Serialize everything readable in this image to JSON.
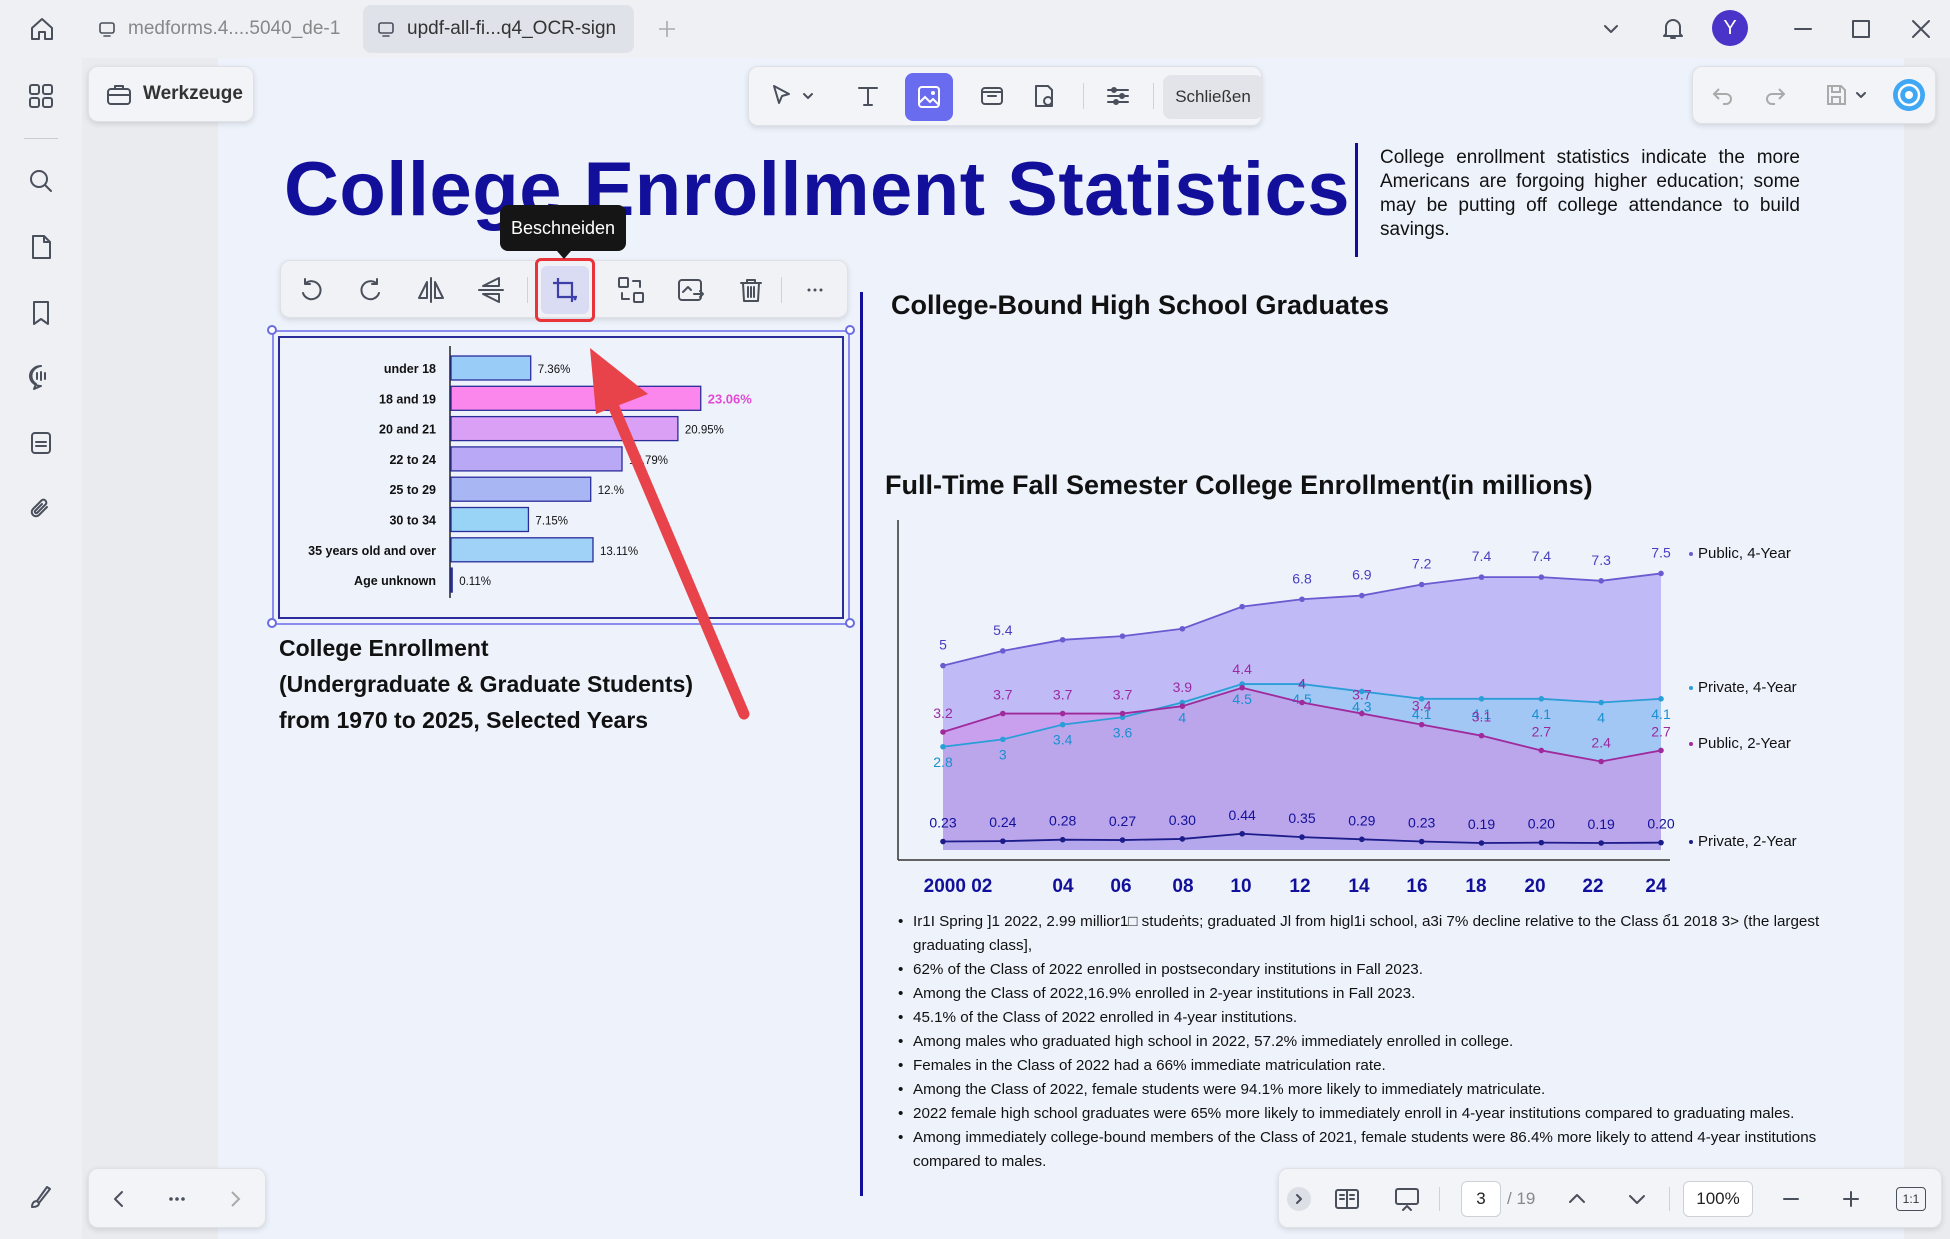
{
  "tabs": [
    {
      "label": "medforms.4....5040_de-1"
    },
    {
      "label": "updf-all-fi...q4_OCR-sign"
    }
  ],
  "user": {
    "avatar_letter": "Y",
    "avatar_color": "#4a33c9"
  },
  "toolbar": {
    "tools_label": "Werkzeuge",
    "close_label": "Schließen"
  },
  "tooltip": "Beschneiden",
  "document": {
    "title": "College Enrollment Statistics",
    "intro": "College enrollment statistics indicate the more Americans are forgoing higher education; some may be putting off college attendance to build savings.",
    "subheading": "College-Bound High School Graduates",
    "enrollment_caption": [
      "College Enrollment",
      "(Undergraduate & Graduate Students)",
      "from 1970 to 2025, Selected Years"
    ],
    "bullets": [
      "Ir1I Spring ]1 2022, 2.99 millior1□ studeṅts; graduated Jl from higl1i school, a3i 7% decline relative to the Class ổ1 2018 3> (the largest graduating class],",
      "62% of the Class of 2022 enrolled in postsecondary institutions in Fall 2023.",
      "Among the Class of 2022,16.9% enrolled in 2-year institutions in Fall 2023.",
      "45.1% of the Class of 2022 enrolled in 4-year institutions.",
      "Among males who graduated high school in 2022, 57.2% immediately enrolled in college.",
      "Females in the Class of 2022 had a 66% immediate matriculation rate.",
      "Among the Class of 2022, female students were 94.1% more likely to immediately matriculate.",
      "2022 female high school graduates were 65% more likely to immediately enroll in 4-year institutions compared to graduating males.",
      "Among immediately college-bound members of the Class of 2021, female students were 86.4% more likely to attend 4-year institutions compared to males."
    ]
  },
  "chart_data": [
    {
      "type": "bar",
      "orientation": "horizontal",
      "categories": [
        "under 18",
        "18 and 19",
        "20 and 21",
        "22 to 24",
        "25 to 29",
        "30 to 34",
        "35 years old and over",
        "Age unknown"
      ],
      "values": [
        7.36,
        23.06,
        20.95,
        15.79,
        12.9,
        7.15,
        13.11,
        0.11
      ],
      "value_labels": [
        "7.36%",
        "23.06%",
        "20.95%",
        "15.79%",
        "12.%",
        "7.15%",
        "13.11%",
        "0.11%"
      ],
      "colors": [
        "#99ccf6",
        "#fb86ec",
        "#d9a0f6",
        "#b8a8f6",
        "#a9b6f4",
        "#99d3f6",
        "#9fd2f6",
        "#9fd2f6"
      ]
    },
    {
      "type": "area",
      "title": "Full-Time Fall Semester College Enrollment(in millions)",
      "x_labels": [
        "2000 02",
        "04",
        "06",
        "08",
        "10",
        "12",
        "14",
        "16",
        "18",
        "20",
        "22",
        "24"
      ],
      "x": [
        2000,
        2002,
        2004,
        2006,
        2008,
        2010,
        2012,
        2014,
        2016,
        2018,
        2020,
        2022,
        2024
      ],
      "series": [
        {
          "name": "Public, 4-Year",
          "color": "#6a5bd0",
          "values": [
            5,
            5.4,
            5.7,
            5.8,
            6.0,
            6.6,
            6.8,
            6.9,
            7.2,
            7.4,
            7.4,
            7.3,
            7.5
          ],
          "labels": [
            "5",
            "5.4",
            "",
            "",
            "",
            "",
            "6.8",
            "6.9",
            "7.2",
            "7.4",
            "7.4",
            "7.3",
            "7.5"
          ]
        },
        {
          "name": "Private, 4-Year",
          "color": "#2b9ed8",
          "values": [
            2.8,
            3,
            3.4,
            3.6,
            4,
            4.5,
            4.5,
            4.3,
            4.1,
            4.1,
            4.1,
            4,
            4.1
          ],
          "labels": [
            "2.8",
            "3",
            "3.4",
            "3.6",
            "4",
            "4.5",
            "4.5",
            "4.3",
            "4.1",
            "4.1",
            "4.1",
            "4",
            "4.1"
          ]
        },
        {
          "name": "Public, 2-Year",
          "color": "#a02a9c",
          "values": [
            3.2,
            3.7,
            3.7,
            3.7,
            3.9,
            4.4,
            4,
            3.7,
            3.4,
            3.1,
            2.7,
            2.4,
            2.7
          ],
          "labels": [
            "3.2",
            "3.7",
            "3.7",
            "3.7",
            "3.9",
            "4.4",
            "4",
            "3.7",
            "3.4",
            "3.1",
            "2.7",
            "2.4",
            "2.7"
          ]
        },
        {
          "name": "Private, 2-Year",
          "color": "#1c1c8a",
          "values": [
            0.23,
            0.24,
            0.28,
            0.27,
            0.3,
            0.44,
            0.35,
            0.29,
            0.23,
            0.19,
            0.2,
            0.19,
            0.2
          ],
          "labels": [
            "0.23",
            "0.24",
            "0.28",
            "0.27",
            "0.30",
            "0.44",
            "0.35",
            "0.29",
            "0.23",
            "0.19",
            "0.20",
            "0.19",
            "0.20"
          ]
        }
      ],
      "ylim": [
        0,
        8
      ],
      "legend": "right"
    }
  ],
  "pagination": {
    "current": "3",
    "total": "/ 19",
    "zoom": "100%",
    "fit_label": "1:1"
  },
  "colors": {
    "accent": "#6a6cf0",
    "title": "#12109a",
    "crop_highlight": "#e8333a",
    "arrow": "#e8424a"
  }
}
